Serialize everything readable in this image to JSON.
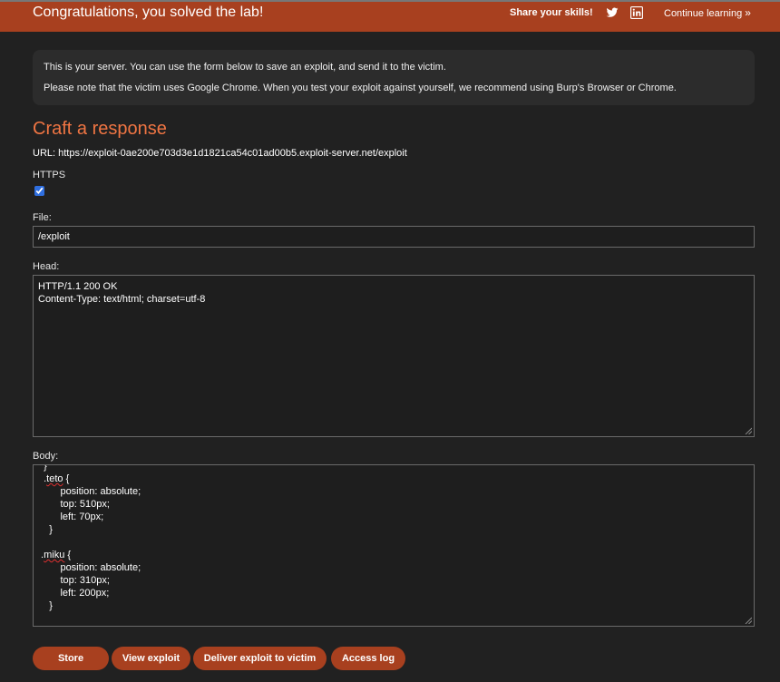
{
  "banner": {
    "title": "Congratulations, you solved the lab!",
    "share_label": "Share your skills!",
    "twitter_icon": "twitter-icon",
    "linkedin_icon": "linkedin-icon",
    "continue_label": "Continue learning",
    "continue_chevron": "»"
  },
  "notice": {
    "line1": "This is your server. You can use the form below to save an exploit, and send it to the victim.",
    "line2": "Please note that the victim uses Google Chrome. When you test your exploit against yourself, we recommend using Burp's Browser or Chrome."
  },
  "form": {
    "heading": "Craft a response",
    "url_line": "URL: https://exploit-0ae200e703d3e1d1821ca54c01ad00b5.exploit-server.net/exploit",
    "https_label": "HTTPS",
    "https_checked": true,
    "file_label": "File:",
    "file_value": "/exploit",
    "head_label": "Head:",
    "head_lines": [
      "HTTP/1.1 200 OK",
      "Content-Type: text/html; charset=utf-8"
    ],
    "body_label": "Body:",
    "body_lines": {
      "l0": "  }",
      "l1_pre": "  .",
      "l1_word": "teto",
      "l1_post": " {",
      "l2": "        position: absolute;",
      "l3": "        top: 510px;",
      "l4": "        left: 70px;",
      "l5": "    }",
      "l6": "",
      "l7_pre": " .",
      "l7_word": "miku",
      "l7_post": " {",
      "l8": "        position: absolute;",
      "l9": "        top: 310px;",
      "l10": "        left: 200px;",
      "l11": "    }"
    }
  },
  "buttons": {
    "store": "Store",
    "view": "View exploit",
    "deliver": "Deliver exploit to victim",
    "log": "Access log"
  },
  "colors": {
    "accent": "#a8401f",
    "heading": "#f07543",
    "background": "#212121"
  }
}
